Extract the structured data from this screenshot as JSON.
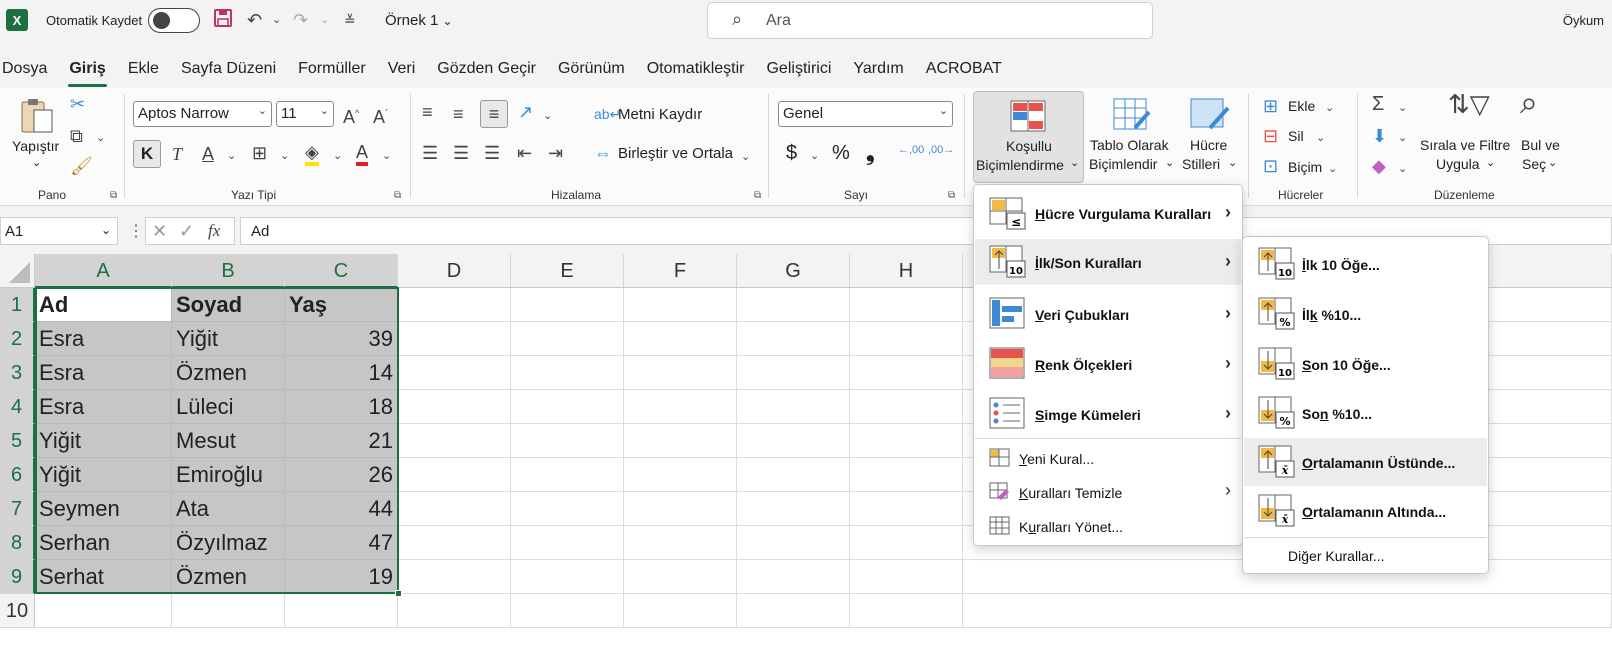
{
  "titlebar": {
    "autosave_label": "Otomatik Kaydet",
    "doc_title": "Örnek 1",
    "search_placeholder": "Ara",
    "user_name": "Öykum"
  },
  "tabs": [
    "Dosya",
    "Giriş",
    "Ekle",
    "Sayfa Düzeni",
    "Formüller",
    "Veri",
    "Gözden Geçir",
    "Görünüm",
    "Otomatikleştir",
    "Geliştirici",
    "Yardım",
    "ACROBAT"
  ],
  "active_tab": "Giriş",
  "ribbon": {
    "clipboard": {
      "paste": "Yapıştır",
      "group": "Pano"
    },
    "font": {
      "name": "Aptos Narrow",
      "size": "11",
      "bold": "K",
      "italic": "T",
      "underline": "A",
      "group": "Yazı Tipi"
    },
    "alignment": {
      "wrap": "Metni Kaydır",
      "merge": "Birleştir ve Ortala",
      "group": "Hizalama"
    },
    "number": {
      "format": "Genel",
      "currency": "$",
      "percent": "%",
      "comma": "❟",
      "inc_decimal": ",00",
      "dec_decimal": ",00",
      "group": "Sayı"
    },
    "styles": {
      "cond_line1": "Koşullu",
      "cond_line2": "Biçimlendirme",
      "table_line1": "Tablo Olarak",
      "table_line2": "Biçimlendir",
      "cell_line1": "Hücre",
      "cell_line2": "Stilleri"
    },
    "cells": {
      "insert": "Ekle",
      "delete": "Sil",
      "format": "Biçim",
      "group": "Hücreler"
    },
    "editing": {
      "sort_line1": "Sırala ve Filtre",
      "sort_line2": "Uygula",
      "find_line1": "Bul ve",
      "find_line2": "Seç",
      "group": "Düzenleme"
    }
  },
  "formula_bar": {
    "name_box": "A1",
    "fx": "fx",
    "content": "Ad"
  },
  "grid": {
    "columns": [
      "A",
      "B",
      "C",
      "D",
      "E",
      "F",
      "G",
      "H"
    ],
    "rows": [
      "1",
      "2",
      "3",
      "4",
      "5",
      "6",
      "7",
      "8",
      "9",
      "10"
    ],
    "data": [
      [
        "Ad",
        "Soyad",
        "Yaş"
      ],
      [
        "Esra",
        "Yiğit",
        "39"
      ],
      [
        "Esra",
        "Özmen",
        "14"
      ],
      [
        "Esra",
        "Lüleci",
        "18"
      ],
      [
        "Yiğit",
        "Mesut",
        "21"
      ],
      [
        "Yiğit",
        "Emiroğlu",
        "26"
      ],
      [
        "Seymen",
        "Ata",
        "44"
      ],
      [
        "Serhan",
        "Özyılmaz",
        "47"
      ],
      [
        "Serhat",
        "Özmen",
        "19"
      ]
    ]
  },
  "cf_menu": {
    "highlight": {
      "pre": "",
      "key": "H",
      "post": "ücre Vurgulama Kuralları"
    },
    "topbottom": {
      "pre": "",
      "key": "İ",
      "post": "lk/Son Kuralları"
    },
    "databars": {
      "pre": "",
      "key": "V",
      "post": "eri Çubukları"
    },
    "colorscales": {
      "pre": "",
      "key": "R",
      "post": "enk Ölçekleri"
    },
    "iconsets": {
      "pre": "",
      "key": "S",
      "post": "imge Kümeleri"
    },
    "newrule": {
      "pre": "",
      "key": "Y",
      "post": "eni Kural..."
    },
    "clearrules": {
      "pre": "",
      "key": "K",
      "post": "uralları Temizle"
    },
    "managerules": {
      "pre": "K",
      "key": "u",
      "post": "ralları Yönet..."
    }
  },
  "sub_menu": {
    "top10": {
      "pre": "",
      "key": "İ",
      "post": "lk 10 Öğe..."
    },
    "top10pct": {
      "pre": "İl",
      "key": "k",
      "post": " %10..."
    },
    "bottom10": {
      "pre": "",
      "key": "S",
      "post": "on 10 Öğe..."
    },
    "bottom10pct": {
      "pre": "So",
      "key": "n",
      "post": " %10..."
    },
    "above": {
      "pre": "",
      "key": "O",
      "post": "rtalamanın Üstünde..."
    },
    "below": {
      "pre": "",
      "key": "O",
      "post": "rtalamanın Altında..."
    },
    "more": {
      "pre": "Di",
      "key": "ğ",
      "post": "er Kurallar..."
    },
    "icon_10": "10",
    "icon_pct": "%",
    "icon_x": "x̄"
  },
  "colors": {
    "accent": "#1d6f42",
    "cf_red": "#e8534f",
    "cf_blue": "#3f8ad6",
    "cf_orange": "#f4b942"
  }
}
